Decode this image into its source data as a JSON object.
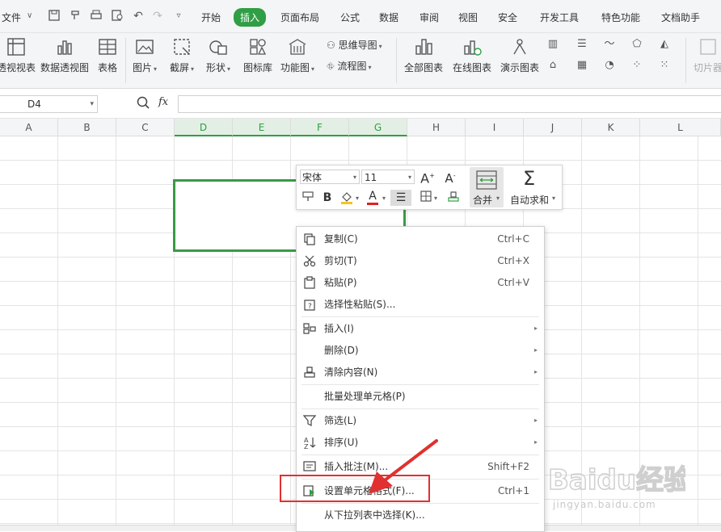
{
  "menubar": {
    "file": "文件",
    "tabs": [
      "开始",
      "插入",
      "页面布局",
      "公式",
      "数据",
      "审阅",
      "视图",
      "安全",
      "开发工具",
      "特色功能",
      "文档助手"
    ],
    "active_tab": "插入"
  },
  "ribbon": {
    "pivot_view": "透视视表",
    "pivot_chart": "数据透视图",
    "table": "表格",
    "picture": "图片",
    "screenshot": "截屏",
    "shape": "形状",
    "icon_lib": "图标库",
    "func_chart": "功能图",
    "mindmap": "思维导图",
    "flowchart": "流程图",
    "all_charts": "全部图表",
    "online_charts": "在线图表",
    "demo_charts": "演示图表",
    "slicer": "切片器"
  },
  "formula_bar": {
    "cell_ref": "D4",
    "fx": "fx",
    "value": ""
  },
  "columns": [
    "A",
    "B",
    "C",
    "D",
    "E",
    "F",
    "G",
    "H",
    "I",
    "J",
    "K",
    "L"
  ],
  "mini_toolbar": {
    "font": "宋体",
    "size": "11",
    "bold": "B",
    "font_color": "A",
    "grow_font": "A",
    "shrink_font": "A",
    "merge": "合并",
    "autosum": "自动求和"
  },
  "context_menu": {
    "copy": {
      "label": "复制(C)",
      "shortcut": "Ctrl+C"
    },
    "cut": {
      "label": "剪切(T)",
      "shortcut": "Ctrl+X"
    },
    "paste": {
      "label": "粘贴(P)",
      "shortcut": "Ctrl+V"
    },
    "paste_special": {
      "label": "选择性粘贴(S)..."
    },
    "insert": {
      "label": "插入(I)"
    },
    "delete": {
      "label": "删除(D)"
    },
    "clear": {
      "label": "清除内容(N)"
    },
    "batch": {
      "label": "批量处理单元格(P)"
    },
    "filter": {
      "label": "筛选(L)"
    },
    "sort": {
      "label": "排序(U)"
    },
    "comment": {
      "label": "插入批注(M)...",
      "shortcut": "Shift+F2"
    },
    "format_cells": {
      "label": "设置单元格格式(F)...",
      "shortcut": "Ctrl+1"
    },
    "pick_list": {
      "label": "从下拉列表中选择(K)..."
    }
  },
  "watermark": {
    "brand": "Baidu经验",
    "url": "jingyan.baidu.com"
  },
  "colors": {
    "accent_green": "#2f9e44",
    "highlight_red": "#e03030"
  }
}
